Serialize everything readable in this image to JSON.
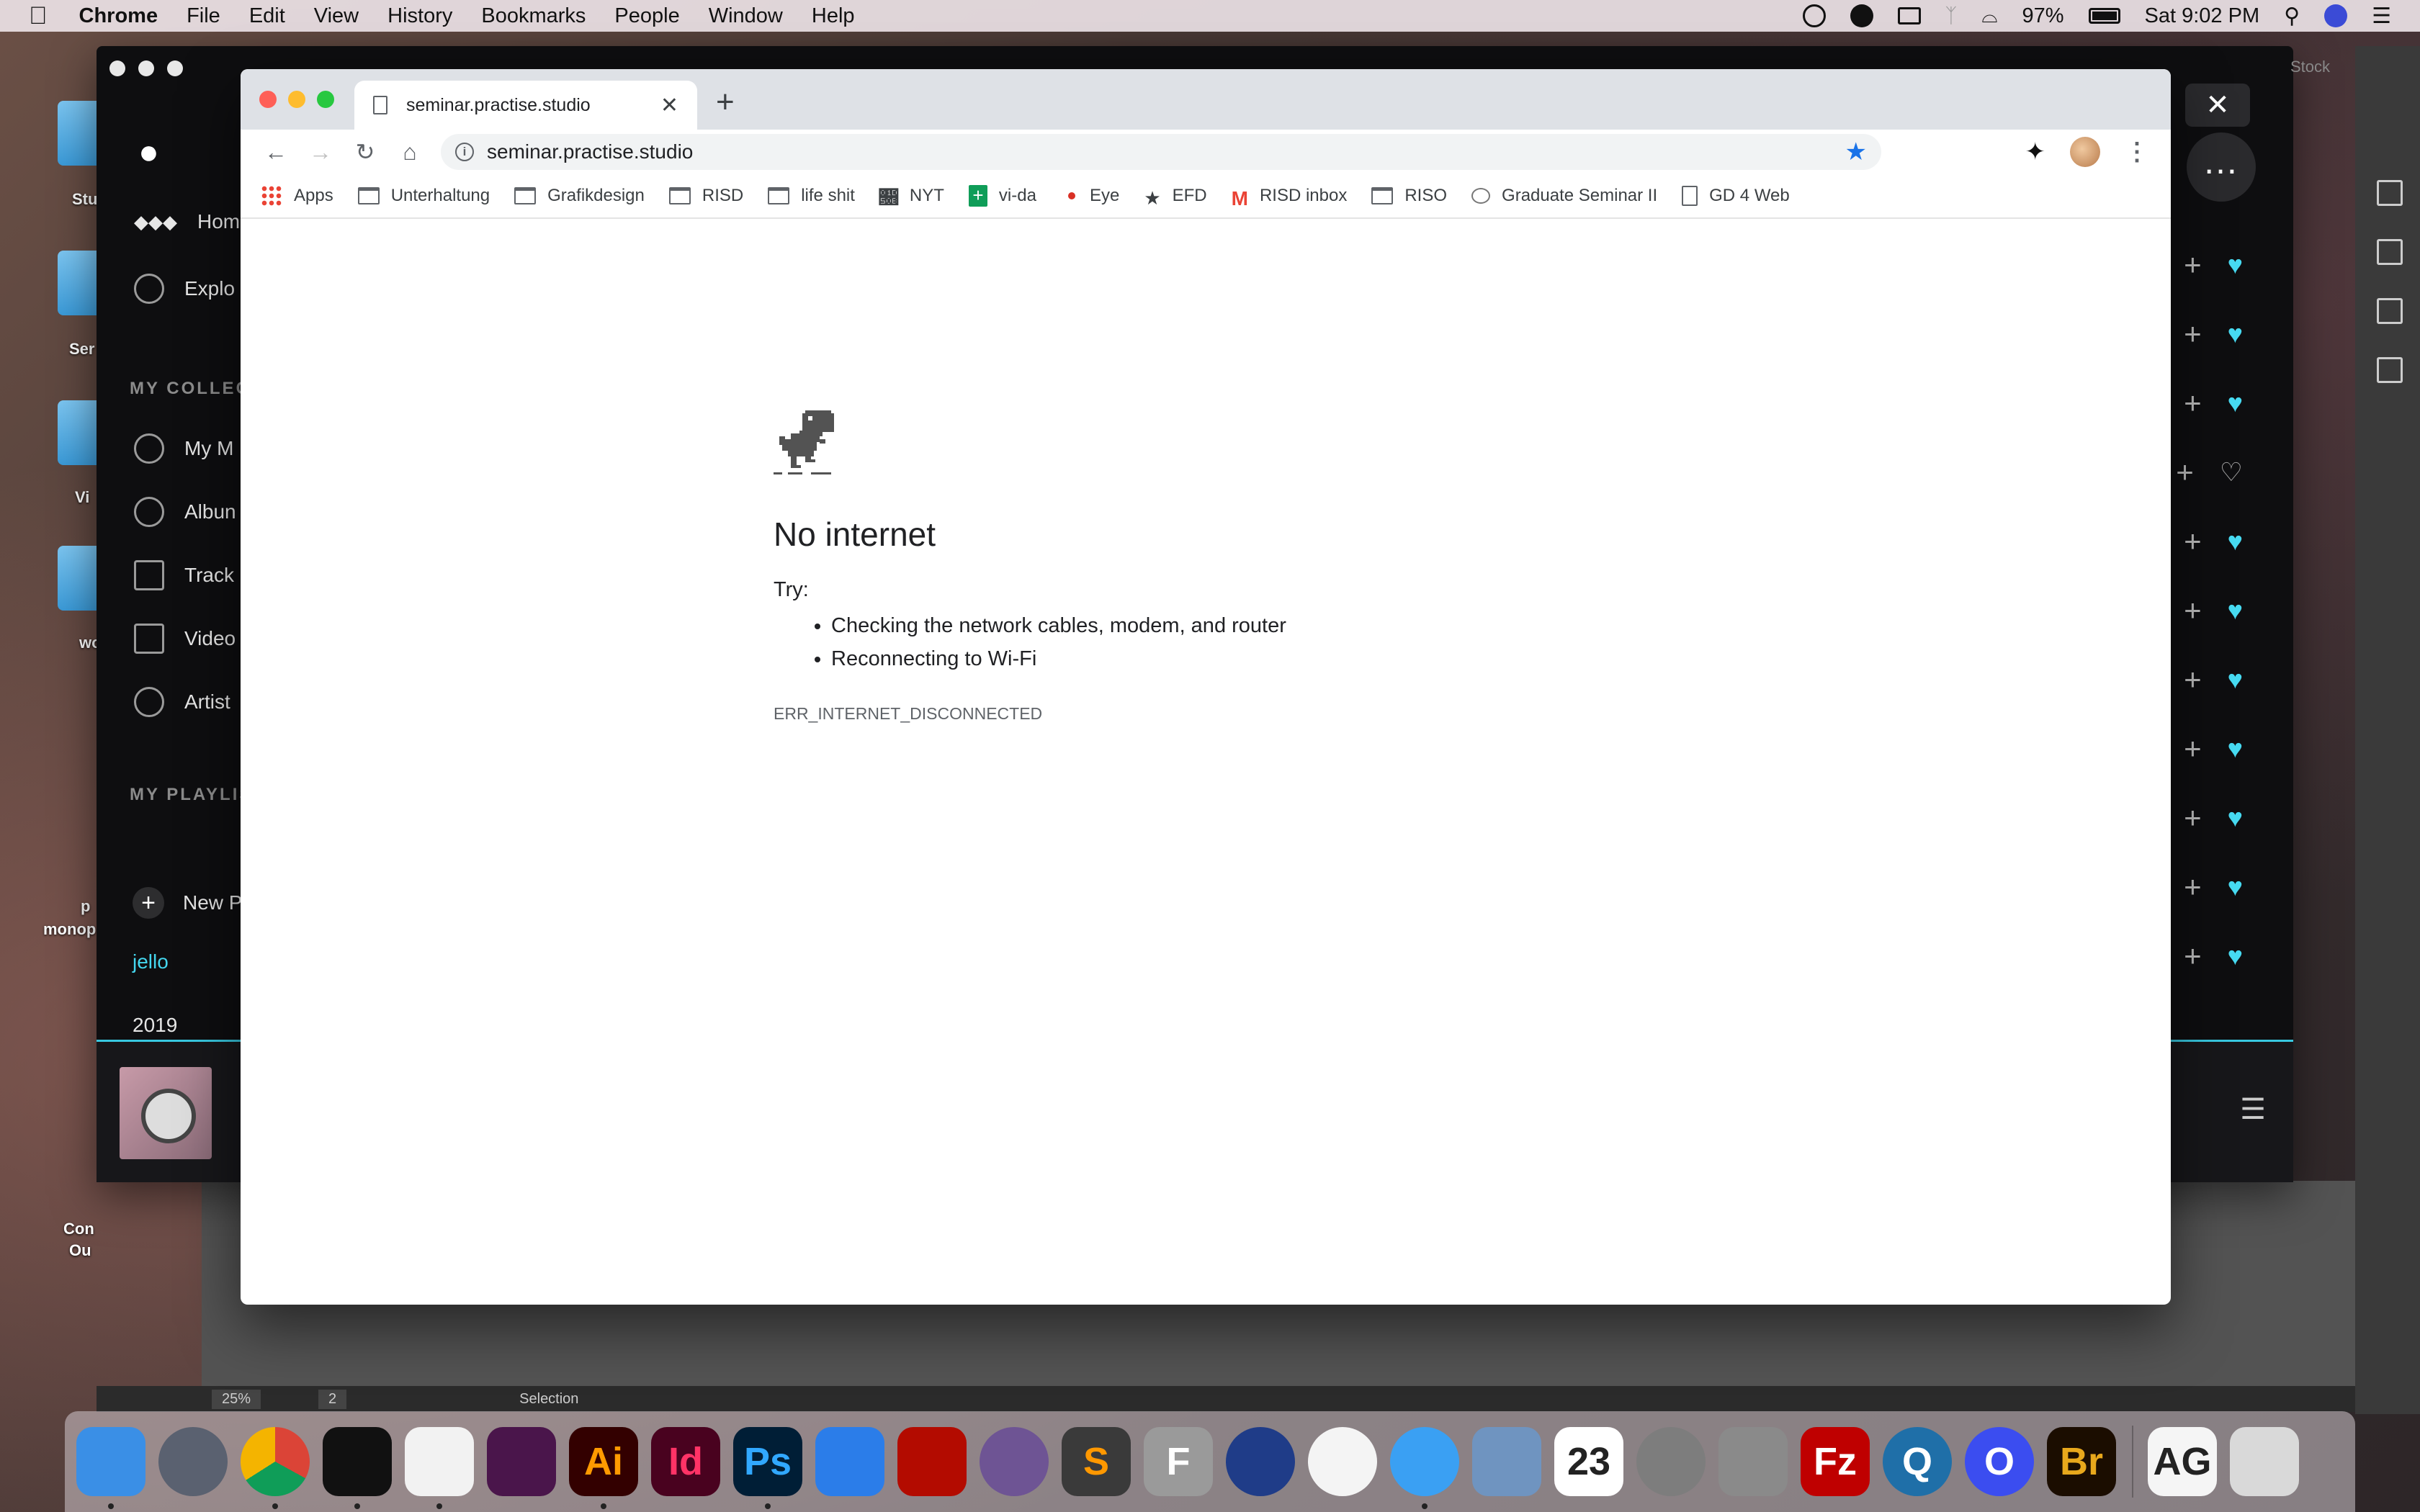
{
  "menubar": {
    "app_name": "Chrome",
    "menus": [
      "File",
      "Edit",
      "View",
      "History",
      "Bookmarks",
      "People",
      "Window",
      "Help"
    ],
    "battery": "97%",
    "clock": "Sat 9:02 PM"
  },
  "desktop": {
    "labels": [
      "Stu",
      "Ser",
      "Vi",
      "wo",
      "p",
      "monop",
      "Con",
      "Ou"
    ]
  },
  "tidal": {
    "nav": [
      {
        "label": "Home",
        "icon": "tidal-logo-icon"
      },
      {
        "label": "Explo",
        "icon": "compass-icon"
      }
    ],
    "collection_header": "MY COLLECT",
    "collection": [
      {
        "label": "My M",
        "icon": "radio-icon"
      },
      {
        "label": "Albun",
        "icon": "disc-icon"
      },
      {
        "label": "Track",
        "icon": "music-note-icon"
      },
      {
        "label": "Video",
        "icon": "video-icon"
      },
      {
        "label": "Artist",
        "icon": "microphone-icon"
      }
    ],
    "playlists_header": "MY PLAYLIS",
    "new_playlist": "New P",
    "playlists": [
      "jello",
      "2019"
    ],
    "rows_liked": [
      true,
      true,
      true,
      false,
      true,
      true,
      true,
      true,
      true,
      true,
      true
    ],
    "accent_color": "#44d6ee"
  },
  "illustrator": {
    "stock_label": "Stock",
    "zoom": "25%",
    "page": "2",
    "tool": "Selection"
  },
  "chrome": {
    "tab_title": "seminar.practise.studio",
    "url": "seminar.practise.studio",
    "bookmarks": [
      {
        "label": "Apps",
        "icon": "apps-icon"
      },
      {
        "label": "Unterhaltung",
        "icon": "folder-icon"
      },
      {
        "label": "Grafikdesign",
        "icon": "folder-icon"
      },
      {
        "label": "RISD",
        "icon": "folder-icon"
      },
      {
        "label": "life shit",
        "icon": "folder-icon"
      },
      {
        "label": "NYT",
        "icon": "nyt-icon"
      },
      {
        "label": "vi-da",
        "icon": "sheets-icon"
      },
      {
        "label": "Eye",
        "icon": "eye-dot-icon"
      },
      {
        "label": "EFD",
        "icon": "star-icon"
      },
      {
        "label": "RISD inbox",
        "icon": "gmail-icon"
      },
      {
        "label": "RISO",
        "icon": "folder-icon"
      },
      {
        "label": "Graduate Seminar II",
        "icon": "chat-icon"
      },
      {
        "label": "GD 4 Web",
        "icon": "document-icon"
      }
    ]
  },
  "error_page": {
    "title": "No internet",
    "try_label": "Try:",
    "suggestions": [
      "Checking the network cables, modem, and router",
      "Reconnecting to Wi-Fi"
    ],
    "code": "ERR_INTERNET_DISCONNECTED"
  },
  "dock": {
    "apps": [
      {
        "name": "finder-icon",
        "label": "",
        "color": "#3a8fe6"
      },
      {
        "name": "launchpad-icon",
        "label": "",
        "color": "#5a6170"
      },
      {
        "name": "chrome-icon",
        "label": "",
        "color": "#e8e8e8"
      },
      {
        "name": "tidal-icon",
        "label": "",
        "color": "#111111"
      },
      {
        "name": "textedit-icon",
        "label": "",
        "color": "#f2f2f2"
      },
      {
        "name": "slack-icon",
        "label": "",
        "color": "#4a154b"
      },
      {
        "name": "illustrator-icon",
        "label": "Ai",
        "color": "#330000",
        "text_color": "#ff9a00"
      },
      {
        "name": "indesign-icon",
        "label": "Id",
        "color": "#49021f",
        "text_color": "#ff3366"
      },
      {
        "name": "photoshop-icon",
        "label": "Ps",
        "color": "#001e36",
        "text_color": "#31a8ff"
      },
      {
        "name": "keynote-icon",
        "label": "",
        "color": "#2b7de9"
      },
      {
        "name": "acrobat-icon",
        "label": "",
        "color": "#b30b00"
      },
      {
        "name": "github-icon",
        "label": "",
        "color": "#6e5494"
      },
      {
        "name": "sublime-icon",
        "label": "S",
        "color": "#3a3a3a",
        "text_color": "#ff9800"
      },
      {
        "name": "fontlab-icon",
        "label": "F",
        "color": "#9a9a9a",
        "text_color": "#ffffff"
      },
      {
        "name": "cinema4d-icon",
        "label": "",
        "color": "#1f3c88"
      },
      {
        "name": "photos-icon",
        "label": "",
        "color": "#f4f4f4"
      },
      {
        "name": "messages-icon",
        "label": "",
        "color": "#3aa0f3"
      },
      {
        "name": "preview-icon",
        "label": "",
        "color": "#6f94c0"
      },
      {
        "name": "calendar-icon",
        "label": "23",
        "color": "#ffffff",
        "text_color": "#222222"
      },
      {
        "name": "system-preferences-icon",
        "label": "",
        "color": "#7d7d7d"
      },
      {
        "name": "calculator-icon",
        "label": "",
        "color": "#8a8a8a"
      },
      {
        "name": "filezilla-icon",
        "label": "Fz",
        "color": "#bf0000",
        "text_color": "#ffffff"
      },
      {
        "name": "quicktime-icon",
        "label": "Q",
        "color": "#1f6fa8",
        "text_color": "#ffffff"
      },
      {
        "name": "circle-app-icon",
        "label": "O",
        "color": "#3b4df0",
        "text_color": "#ffffff"
      },
      {
        "name": "bridge-icon",
        "label": "Br",
        "color": "#1b0d00",
        "text_color": "#e8a81c"
      },
      {
        "name": "font-book-icon",
        "label": "AG",
        "color": "#f5f5f5",
        "text_color": "#222222"
      },
      {
        "name": "trash-icon",
        "label": "",
        "color": "#d9d9d9"
      }
    ]
  }
}
